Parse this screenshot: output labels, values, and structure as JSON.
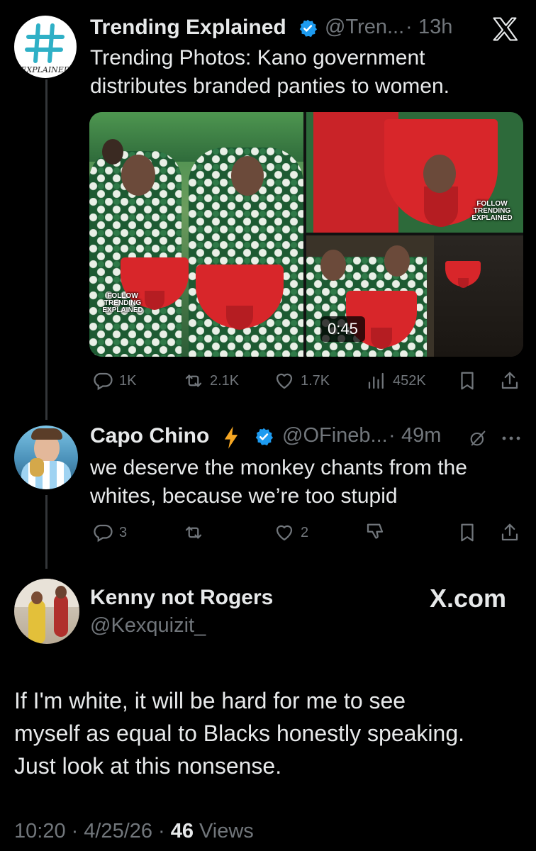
{
  "tweet1": {
    "name": "Trending Explained",
    "handle": "@Tren...",
    "time": "13h",
    "avatar_text": "EXPLAINED",
    "text_line1": "Trending Photos: Kano government",
    "text_line2": "distributes branded panties to women.",
    "video_duration": "0:45",
    "watermark": "FOLLOW TRENDING EXPLAINED",
    "stats": {
      "replies": "1K",
      "retweets": "2.1K",
      "likes": "1.7K",
      "views": "452K"
    }
  },
  "tweet2": {
    "name": "Capo Chino",
    "handle": "@OFineb...",
    "time": "49m",
    "text_line1": "we deserve the monkey chants from the",
    "text_line2": "whites, because we’re too stupid",
    "stats": {
      "replies": "3",
      "likes": "2"
    }
  },
  "main_tweet": {
    "name": "Kenny not Rogers",
    "handle": "@Kexquizit_",
    "brand": "X.com",
    "text_line1": "If I'm white, it will be hard for me to see",
    "text_line2": "myself as equal to Blacks honestly speaking.",
    "text_line3": "Just look at this nonsense.",
    "time": "10:20",
    "date": "4/25/26",
    "views_count": "46",
    "views_label": "Views",
    "separator": "·"
  },
  "colors": {
    "background": "#000000",
    "text": "#e7e9ea",
    "muted": "#71767b",
    "verified": "#1d9bf0",
    "lightning": "#f5a623"
  }
}
